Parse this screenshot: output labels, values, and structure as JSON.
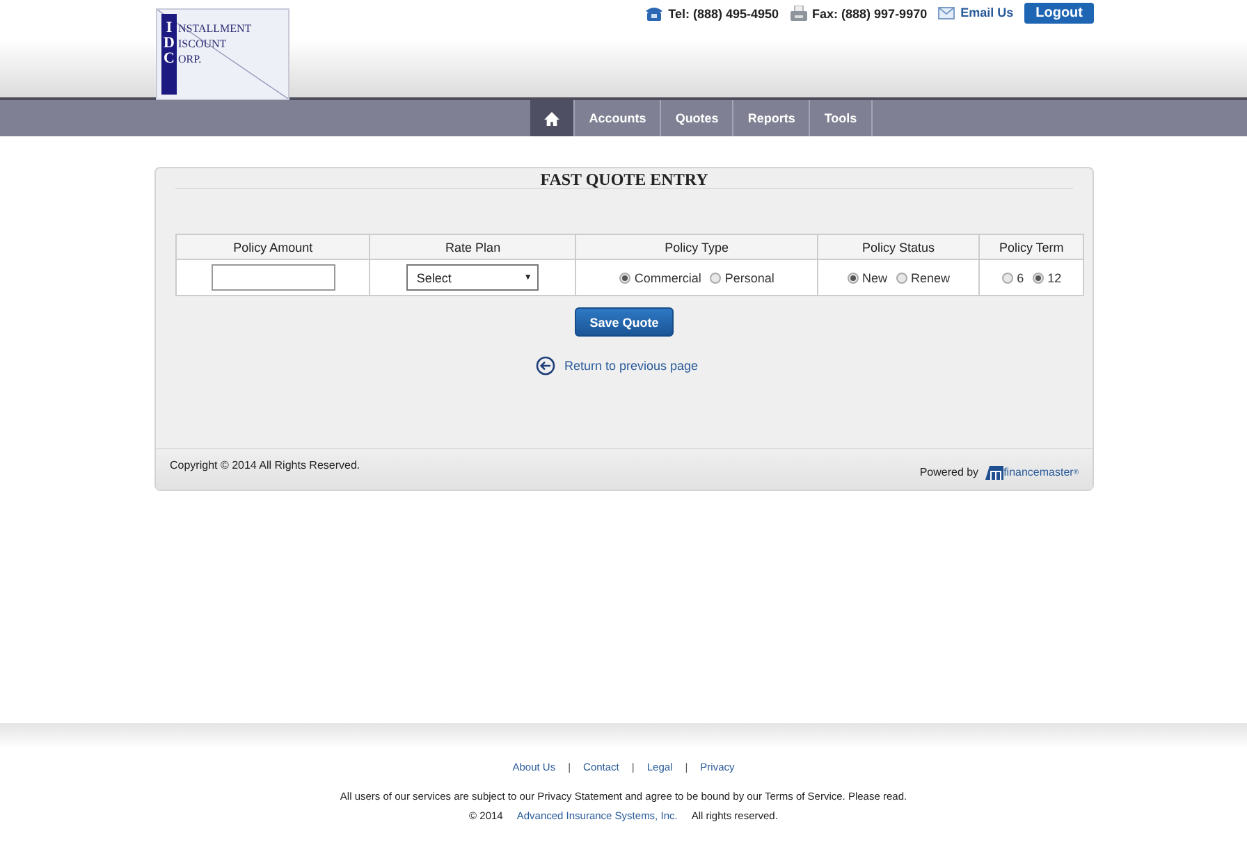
{
  "logo": {
    "lines": [
      {
        "initial": "I",
        "rest": "NSTALLMENT"
      },
      {
        "initial": "D",
        "rest": "ISCOUNT"
      },
      {
        "initial": "C",
        "rest": "ORP."
      }
    ]
  },
  "contact": {
    "phone": "Tel: (888) 495-4950",
    "fax": "Fax: (888) 997-9970",
    "email": "Email Us",
    "logout": "Logout"
  },
  "nav": [
    {
      "kind": "home",
      "selected": true
    },
    {
      "kind": "text",
      "label": "Accounts",
      "selected": false
    },
    {
      "kind": "text",
      "label": "Quotes",
      "selected": false
    },
    {
      "kind": "text",
      "label": "Reports",
      "selected": false
    },
    {
      "kind": "text",
      "label": "Tools",
      "selected": false
    }
  ],
  "form": {
    "title": "FAST QUOTE ENTRY",
    "columns": [
      {
        "heading": "Policy Amount",
        "kind": "input"
      },
      {
        "heading": "Rate Plan",
        "kind": "select",
        "value": "Select",
        "caret": "▼"
      },
      {
        "heading": "Policy Type",
        "kind": "radio",
        "options": [
          {
            "label": "Commercial",
            "selected": true
          },
          {
            "label": "Personal",
            "selected": false
          }
        ]
      },
      {
        "heading": "Policy Status",
        "kind": "radio",
        "options": [
          {
            "label": "New",
            "selected": true
          },
          {
            "label": "Renew",
            "selected": false
          }
        ]
      },
      {
        "heading": "Policy Term",
        "kind": "radio",
        "options": [
          {
            "label": "6",
            "selected": false
          },
          {
            "label": "12",
            "selected": true
          }
        ]
      }
    ],
    "save": "Save Quote",
    "back": "Return to previous page",
    "copyright": "Copyright © 2014 All Rights Reserved.",
    "powered": "Powered by",
    "brand": "financemaster",
    "brand_mark": "®"
  },
  "footer": {
    "links": [
      "About Us",
      "Contact",
      "Legal",
      "Privacy"
    ],
    "separator": "|",
    "notice": "All users of our services are subject to our Privacy Statement and agree to be bound by our Terms of Service. Please read.",
    "year": "© 2014",
    "company": "Advanced Insurance Systems, Inc.",
    "rights": "All rights reserved."
  }
}
